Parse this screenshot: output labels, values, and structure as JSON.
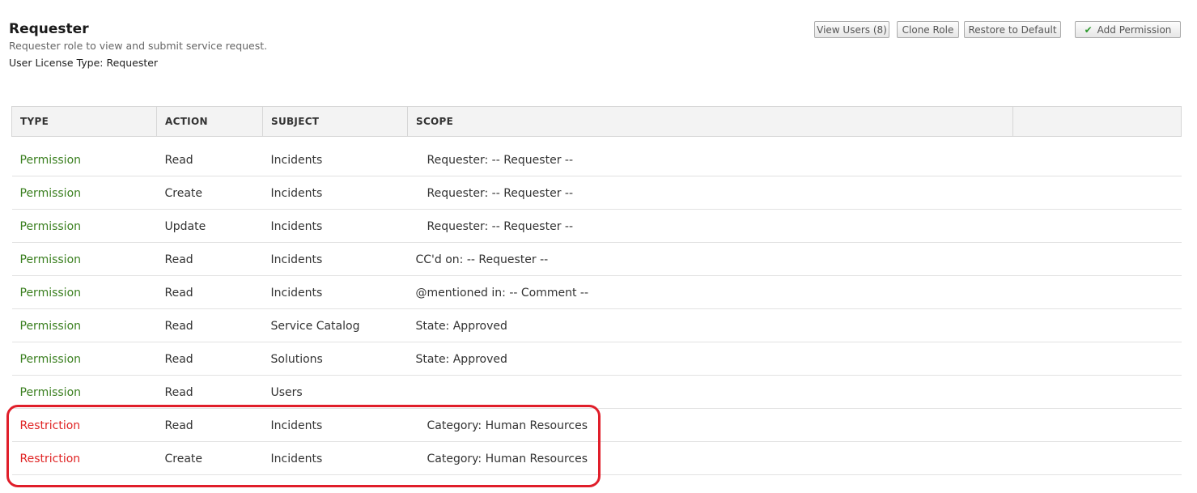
{
  "role": {
    "title": "Requester",
    "description": "Requester role to view and submit service request.",
    "license": "User License Type: Requester"
  },
  "toolbar": {
    "view_users": "View Users (8)",
    "clone_role": "Clone Role",
    "restore_default": "Restore to Default",
    "add_permission": "Add Permission"
  },
  "table": {
    "headers": [
      "TYPE",
      "ACTION",
      "SUBJECT",
      "SCOPE",
      ""
    ],
    "rows": [
      {
        "type": "Permission",
        "action": "Read",
        "subject": "Incidents",
        "scope": "Requester: -- Requester --"
      },
      {
        "type": "Permission",
        "action": "Create",
        "subject": "Incidents",
        "scope": "Requester: -- Requester --"
      },
      {
        "type": "Permission",
        "action": "Update",
        "subject": "Incidents",
        "scope": "Requester: -- Requester --"
      },
      {
        "type": "Permission",
        "action": "Read",
        "subject": "Incidents",
        "scope": "CC'd on: -- Requester --"
      },
      {
        "type": "Permission",
        "action": "Read",
        "subject": "Incidents",
        "scope": "@mentioned in: -- Comment --"
      },
      {
        "type": "Permission",
        "action": "Read",
        "subject": "Service Catalog",
        "scope": "State: Approved"
      },
      {
        "type": "Permission",
        "action": "Read",
        "subject": "Solutions",
        "scope": "State: Approved"
      },
      {
        "type": "Permission",
        "action": "Read",
        "subject": "Users",
        "scope": ""
      },
      {
        "type": "Restriction",
        "action": "Read",
        "subject": "Incidents",
        "scope": "Category: Human Resources"
      },
      {
        "type": "Restriction",
        "action": "Create",
        "subject": "Incidents",
        "scope": "Category: Human Resources"
      }
    ]
  },
  "colors": {
    "permission": "#3a7f1f",
    "restriction": "#e02424",
    "highlight": "#e01e2a"
  },
  "icons": {
    "add_permission": "check-icon"
  }
}
